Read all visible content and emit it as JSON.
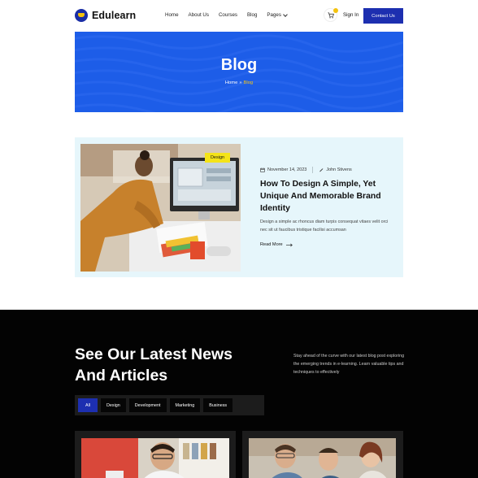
{
  "header": {
    "logo_text": "Edulearn",
    "nav": [
      {
        "label": "Home"
      },
      {
        "label": "About Us"
      },
      {
        "label": "Courses"
      },
      {
        "label": "Blog"
      },
      {
        "label": "Pages",
        "has_dropdown": true
      }
    ],
    "cart_icon": "cart-icon",
    "sign_in": "Sign In",
    "contact": "Contact Us"
  },
  "hero": {
    "title": "Blog",
    "breadcrumb": {
      "home": "Home",
      "separator": "»",
      "current": "Blog"
    }
  },
  "featured": {
    "tag": "Design",
    "date": "November 14, 2023",
    "author": "John Stivens",
    "title": "How To Design A Simple, Yet Unique And Memorable Brand Identity",
    "excerpt": "Design a simple ac rhoncus diam turpis consequat vitaes velit orci nec sit ut faucibus tristique facilisi accumsan",
    "read_more": "Read More"
  },
  "latest": {
    "title": "See Our Latest News And Articles",
    "intro": "Stay ahead of the curve with our latest blog post exploring the emerging trends in e-learning. Learn valuable tips and techniques to effectively",
    "filters": [
      "All",
      "Design",
      "Development",
      "Marketing",
      "Business"
    ],
    "active_filter": "All"
  },
  "colors": {
    "brand_blue": "#1d2fb0",
    "hero_blue": "#1d5de8",
    "accent_yellow": "#f4c20d",
    "featured_bg": "#e6f6fb",
    "dark_bg": "#030303"
  }
}
